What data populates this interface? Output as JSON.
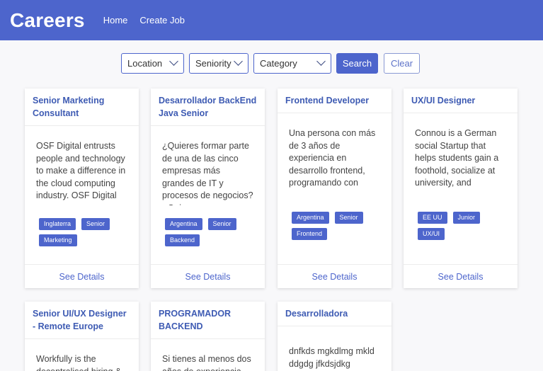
{
  "navbar": {
    "brand": "Careers",
    "links": [
      "Home",
      "Create Job"
    ]
  },
  "filters": {
    "location_label": "Location",
    "seniority_label": "Seniority",
    "category_label": "Category",
    "search_label": "Search",
    "clear_label": "Clear"
  },
  "details_label": "See Details",
  "jobs": [
    {
      "title": "Senior Marketing Consultant",
      "description": "OSF Digital entrusts people and technology to make a difference in the cloud computing industry. OSF Digital",
      "tags": [
        "Inglaterra",
        "Senior",
        "Marketing"
      ]
    },
    {
      "title": "Desarrollador BackEnd Java Senior",
      "description": "¿Quieres formar parte de una de las cinco empresas más grandes de IT y procesos de negocios? ¿Quieres",
      "tags": [
        "Argentina",
        "Senior",
        "Backend"
      ]
    },
    {
      "title": "Frontend Developer",
      "description": "Una persona con más de 3 años de experiencia en desarrollo frontend, programando con",
      "tags": [
        "Argentina",
        "Senior",
        "Frontend"
      ]
    },
    {
      "title": "UX/UI Designer",
      "description": "Connou is a German social Startup that helps students gain a foothold, socialize at university, and digitalize",
      "tags": [
        "EE UU",
        "Junior",
        "UX/UI"
      ]
    },
    {
      "title": "Senior UI/UX Designer - Remote Europe",
      "description": "Workfully is the decentralised hiring &"
    },
    {
      "title": "PROGRAMADOR BACKEND",
      "description": "Si tienes al menos dos años de experiencia en"
    },
    {
      "title": "Desarrolladora",
      "description": "dnfkds mgkdlmg mkld ddgdg jfkdsjdkg gjksgjd"
    }
  ]
}
